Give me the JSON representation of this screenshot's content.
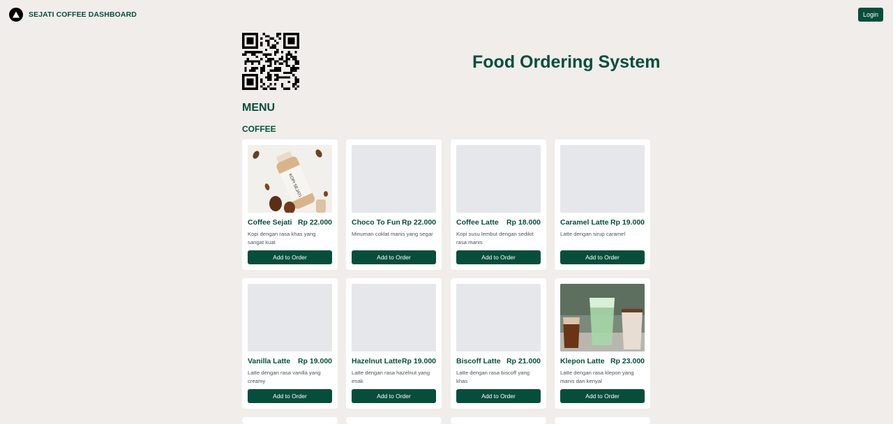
{
  "navbar": {
    "brand": "SEJATI COFFEE DASHBOARD",
    "logo_icon": "triangle-logo-icon",
    "login_label": "Login"
  },
  "hero": {
    "title": "Food Ordering System",
    "qr_icon": "qr-code-icon"
  },
  "menu": {
    "heading": "MENU",
    "categories": [
      {
        "name": "COFFEE",
        "items": [
          {
            "name": "Coffee Sejati",
            "price": "Rp 22.000",
            "description": "Kopi dengan rasa khas yang sangat kuat",
            "image": "coffee-bottle-photo",
            "button": "Add to Order"
          },
          {
            "name": "Choco To Fun",
            "price": "Rp 22.000",
            "description": "Minuman coklat manis yang segar",
            "image": "placeholder",
            "button": "Add to Order"
          },
          {
            "name": "Coffee Latte",
            "price": "Rp 18.000",
            "description": "Kopi susu lembut dengan sedikit rasa manis",
            "image": "placeholder",
            "button": "Add to Order"
          },
          {
            "name": "Caramel Latte",
            "price": "Rp 19.000",
            "description": "Latte dengan sirup caramel",
            "image": "placeholder",
            "button": "Add to Order"
          },
          {
            "name": "Vanilla Latte",
            "price": "Rp 19.000",
            "description": "Latte dengan rasa vanilla yang creamy",
            "image": "placeholder",
            "button": "Add to Order"
          },
          {
            "name": "Hazelnut Latte",
            "price": "Rp 19.000",
            "description": "Latte dengan rasa hazelnut yang enak",
            "image": "placeholder",
            "button": "Add to Order"
          },
          {
            "name": "Biscoff Latte",
            "price": "Rp 21.000",
            "description": "Latte dengan rasa biscoff yang khas",
            "image": "placeholder",
            "button": "Add to Order"
          },
          {
            "name": "Klepon Latte",
            "price": "Rp 23.000",
            "description": "Latte dengan rasa klepon yang manis dan kenyal",
            "image": "iced-drinks-photo",
            "button": "Add to Order"
          }
        ]
      }
    ]
  },
  "colors": {
    "primary": "#064e3b",
    "background": "#f0edea",
    "card": "#ffffff",
    "placeholder": "#e5e7eb"
  }
}
